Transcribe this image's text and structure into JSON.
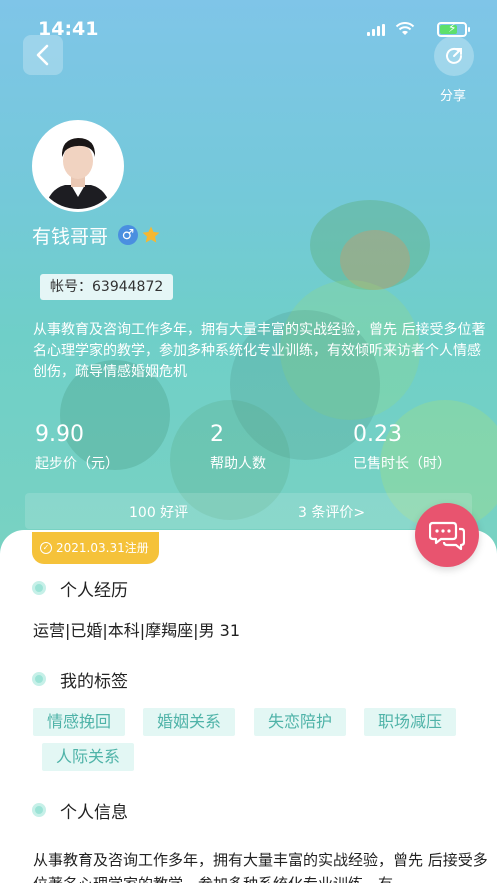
{
  "status_bar": {
    "time": "14:41"
  },
  "header": {
    "share_label": "分享"
  },
  "profile": {
    "name": "有钱哥哥",
    "gender_symbol": "♂",
    "account_label": "帐号：63944872",
    "bio": "从事教育及咨询工作多年，拥有大量丰富的实战经验，曾先 后接受多位著名心理学家的教学，参加多种系统化专业训练，有效倾听来访者个人情感创伤，疏导情感婚姻危机"
  },
  "stats": [
    {
      "value": "9.90",
      "label": "起步价（元）"
    },
    {
      "value": "2",
      "label": "帮助人数"
    },
    {
      "value": "0.23",
      "label": "已售时长（时）"
    }
  ],
  "reviews": {
    "good": "100 好评",
    "count": "3 条评价>"
  },
  "registration": "2021.03.31注册",
  "sections": {
    "experience_title": "个人经历",
    "experience_text": "运营|已婚|本科|摩羯座|男 31",
    "tags_title": "我的标签",
    "tags": [
      "情感挽回",
      "婚姻关系",
      "失恋陪护",
      "职场减压",
      "人际关系"
    ],
    "info_title": "个人信息",
    "info_text": "从事教育及咨询工作多年，拥有大量丰富的实战经验，曾先 后接受多位著名心理学家的教学，参加多种系统化专业训练，有"
  },
  "colors": {
    "accent_teal": "#4fb3a8",
    "badge_yellow": "#f5c23a",
    "chat_red": "#e8546f"
  },
  "icons": [
    "back-arrow-icon",
    "share-icon",
    "male-icon",
    "star-icon",
    "check-circle-icon",
    "chat-icon"
  ]
}
